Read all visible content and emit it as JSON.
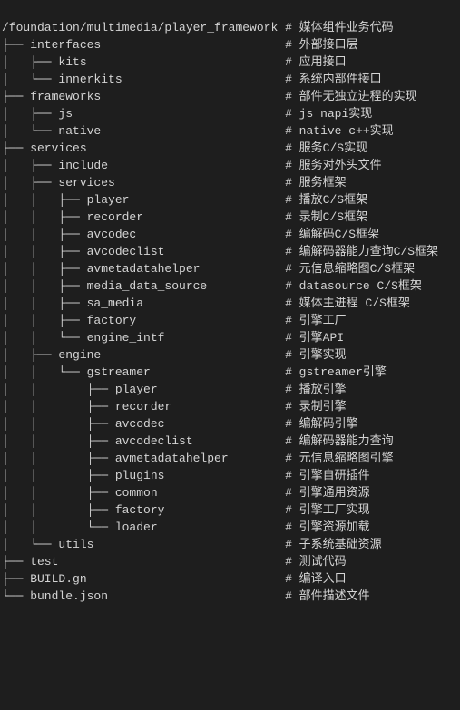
{
  "root_path": "/foundation/multimedia/player_framework",
  "root_comment": "媒体组件业务代码",
  "entries": [
    {
      "depth": 0,
      "last": false,
      "name": "interfaces",
      "comment": "外部接口层",
      "prefix": ""
    },
    {
      "depth": 1,
      "last": false,
      "name": "kits",
      "comment": "应用接口",
      "prefix": "│   "
    },
    {
      "depth": 1,
      "last": true,
      "name": "innerkits",
      "comment": "系统内部件接口",
      "prefix": "│   "
    },
    {
      "depth": 0,
      "last": false,
      "name": "frameworks",
      "comment": "部件无独立进程的实现",
      "prefix": ""
    },
    {
      "depth": 1,
      "last": false,
      "name": "js",
      "comment": "js napi实现",
      "prefix": "│   "
    },
    {
      "depth": 1,
      "last": true,
      "name": "native",
      "comment": "native c++实现",
      "prefix": "│   "
    },
    {
      "depth": 0,
      "last": false,
      "name": "services",
      "comment": "服务C/S实现",
      "prefix": ""
    },
    {
      "depth": 1,
      "last": false,
      "name": "include",
      "comment": "服务对外头文件",
      "prefix": "│   "
    },
    {
      "depth": 1,
      "last": false,
      "name": "services",
      "comment": "服务框架",
      "prefix": "│   "
    },
    {
      "depth": 2,
      "last": false,
      "name": "player",
      "comment": "播放C/S框架",
      "prefix": "│   │   "
    },
    {
      "depth": 2,
      "last": false,
      "name": "recorder",
      "comment": "录制C/S框架",
      "prefix": "│   │   "
    },
    {
      "depth": 2,
      "last": false,
      "name": "avcodec",
      "comment": "编解码C/S框架",
      "prefix": "│   │   "
    },
    {
      "depth": 2,
      "last": false,
      "name": "avcodeclist",
      "comment": "编解码器能力查询C/S框架",
      "prefix": "│   │   "
    },
    {
      "depth": 2,
      "last": false,
      "name": "avmetadatahelper",
      "comment": "元信息缩略图C/S框架",
      "prefix": "│   │   "
    },
    {
      "depth": 2,
      "last": false,
      "name": "media_data_source",
      "comment": "datasource C/S框架",
      "prefix": "│   │   "
    },
    {
      "depth": 2,
      "last": false,
      "name": "sa_media",
      "comment": "媒体主进程 C/S框架",
      "prefix": "│   │   "
    },
    {
      "depth": 2,
      "last": false,
      "name": "factory",
      "comment": "引擎工厂",
      "prefix": "│   │   "
    },
    {
      "depth": 2,
      "last": true,
      "name": "engine_intf",
      "comment": "引擎API",
      "prefix": "│   │   "
    },
    {
      "depth": 1,
      "last": false,
      "name": "engine",
      "comment": "引擎实现",
      "prefix": "│   "
    },
    {
      "depth": 2,
      "last": true,
      "name": "gstreamer",
      "comment": "gstreamer引擎",
      "prefix": "│   │   "
    },
    {
      "depth": 3,
      "last": false,
      "name": "player",
      "comment": "播放引擎",
      "prefix": "│   │       "
    },
    {
      "depth": 3,
      "last": false,
      "name": "recorder",
      "comment": "录制引擎",
      "prefix": "│   │       "
    },
    {
      "depth": 3,
      "last": false,
      "name": "avcodec",
      "comment": "编解码引擎",
      "prefix": "│   │       "
    },
    {
      "depth": 3,
      "last": false,
      "name": "avcodeclist",
      "comment": "编解码器能力查询",
      "prefix": "│   │       "
    },
    {
      "depth": 3,
      "last": false,
      "name": "avmetadatahelper",
      "comment": "元信息缩略图引擎",
      "prefix": "│   │       "
    },
    {
      "depth": 3,
      "last": false,
      "name": "plugins",
      "comment": "引擎自研插件",
      "prefix": "│   │       "
    },
    {
      "depth": 3,
      "last": false,
      "name": "common",
      "comment": "引擎通用资源",
      "prefix": "│   │       "
    },
    {
      "depth": 3,
      "last": false,
      "name": "factory",
      "comment": "引擎工厂实现",
      "prefix": "│   │       "
    },
    {
      "depth": 3,
      "last": true,
      "name": "loader",
      "comment": "引擎资源加载",
      "prefix": "│   │       "
    },
    {
      "depth": 1,
      "last": true,
      "name": "utils",
      "comment": "子系统基础资源",
      "prefix": "│   "
    },
    {
      "depth": 0,
      "last": false,
      "name": "test",
      "comment": "测试代码",
      "prefix": ""
    },
    {
      "depth": 0,
      "last": false,
      "name": "BUILD.gn",
      "comment": "编译入口",
      "prefix": ""
    },
    {
      "depth": 0,
      "last": true,
      "name": "bundle.json",
      "comment": "部件描述文件",
      "prefix": ""
    }
  ],
  "comment_column": 40
}
